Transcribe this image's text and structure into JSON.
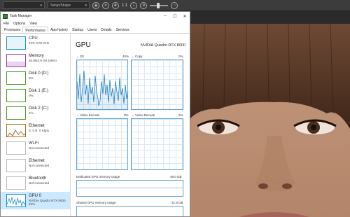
{
  "host": {
    "dropdown1": "",
    "dropdown2": "Setup/Shape",
    "zoom_label": "1:1"
  },
  "window": {
    "title": "Task Manager",
    "controls": [
      "–",
      "☐",
      "✕"
    ]
  },
  "menu": [
    "File",
    "Options",
    "View"
  ],
  "tabs": [
    {
      "label": "Processes",
      "active": false
    },
    {
      "label": "Performance",
      "active": true
    },
    {
      "label": "App history",
      "active": false
    },
    {
      "label": "Startup",
      "active": false
    },
    {
      "label": "Users",
      "active": false
    },
    {
      "label": "Details",
      "active": false
    },
    {
      "label": "Services",
      "active": false
    }
  ],
  "sidebar": [
    {
      "name": "CPU",
      "sub1": "42%  3.06 GHz",
      "sub2": "",
      "color": "#1f8fd1"
    },
    {
      "name": "Memory",
      "sub1": "30.9/63.9 GB (48%)",
      "sub2": "",
      "color": "#9b3fa8"
    },
    {
      "name": "Disk 0 (D:)",
      "sub1": "0%",
      "sub2": "",
      "color": "#4d9a1f"
    },
    {
      "name": "Disk 1 (E:)",
      "sub1": "0%",
      "sub2": "",
      "color": "#4d9a1f"
    },
    {
      "name": "Disk 2 (C:)",
      "sub1": "4%",
      "sub2": "",
      "color": "#4d9a1f"
    },
    {
      "name": "Ethernet",
      "sub1": "S: 0  R: 0 Kbps",
      "sub2": "",
      "color": "#a86c1f"
    },
    {
      "name": "Wi-Fi",
      "sub1": "Not connected",
      "sub2": "",
      "color": "#bbbbbb"
    },
    {
      "name": "Ethernet",
      "sub1": "Not connected",
      "sub2": "",
      "color": "#bbbbbb"
    },
    {
      "name": "Bluetooth",
      "sub1": "Not connected",
      "sub2": "",
      "color": "#bbbbbb"
    },
    {
      "name": "GPU 0",
      "sub1": "NVIDIA Quadro RTX 8000",
      "sub2": "45%",
      "color": "#1f8fd1",
      "selected": true
    }
  ],
  "gpu": {
    "heading": "GPU",
    "model": "NVIDIA Quadro RTX 8000",
    "engines": [
      {
        "label": "3D",
        "pct": "45%"
      },
      {
        "label": "Copy",
        "pct": "0%"
      },
      {
        "label": "Video Encode",
        "pct": "0%"
      },
      {
        "label": "Video Decode",
        "pct": "0%"
      }
    ],
    "dedicated_label": "Dedicated GPU memory usage",
    "dedicated_value": "48.0 GB",
    "shared_label": "Shared GPU memory usage",
    "shared_value": "31.9 GB"
  }
}
